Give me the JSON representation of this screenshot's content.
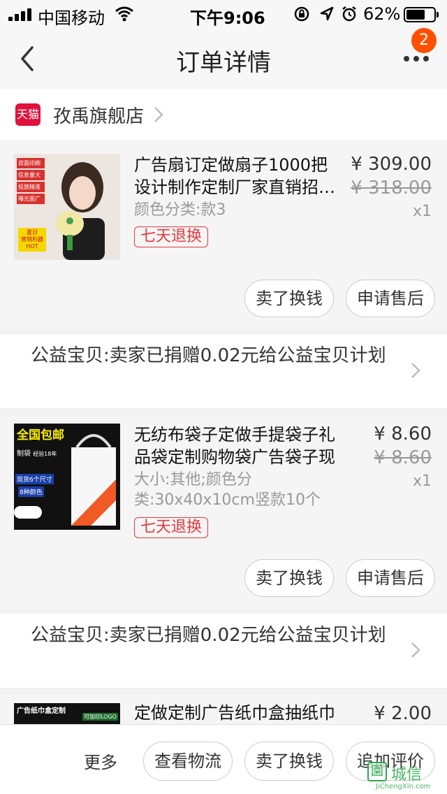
{
  "status_bar": {
    "carrier": "中国移动",
    "time": "下午9:06",
    "battery_percent": "62%",
    "icons": [
      "signal-icon",
      "wifi-icon",
      "lock-rotation-icon",
      "location-arrow-icon",
      "alarm-icon",
      "battery-icon"
    ]
  },
  "nav": {
    "title": "订单详情",
    "badge_count": "2",
    "icons": [
      "back-chevron-icon",
      "more-dots-icon"
    ]
  },
  "shop": {
    "logo_text": "天猫",
    "name": "孜禹旗舰店"
  },
  "items": [
    {
      "title": "广告扇订定做扇子1000把设计制作定制厂家直销招…",
      "sku": "颜色分类:款3",
      "tag": "七天退换",
      "price": "¥ 309.00",
      "original_price": "¥ 318.00",
      "quantity": "x1",
      "buttons": [
        "卖了换钱",
        "申请售后"
      ],
      "thumb_labels": [
        "双面印刷",
        "信息量大",
        "投放精准",
        "曝光面广",
        "夏日",
        "营销利器",
        "HOT"
      ]
    },
    {
      "title": "无纺布袋子定做手提袋子礼品袋定制购物袋广告袋子现货…",
      "sku": "大小:其他;颜色分类:30x40x10cm竖款10个",
      "tag": "七天退换",
      "price": "¥ 8.60",
      "original_price": "¥ 8.60",
      "quantity": "x1",
      "buttons": [
        "卖了换钱",
        "申请售后"
      ],
      "thumb_labels": [
        "全国包邮",
        "制袋",
        "经验18年",
        "现货6个尺寸",
        "8种颜色"
      ]
    },
    {
      "title": "定做定制广告纸巾盒抽纸巾广",
      "price": "¥ 2.00",
      "thumb_labels": [
        "广告纸巾盒定制",
        "可加印LOGO"
      ]
    }
  ],
  "charity": [
    "公益宝贝:卖家已捐赠0.02元给公益宝贝计划",
    "公益宝贝:卖家已捐赠0.02元给公益宝贝计划"
  ],
  "bottom_bar": {
    "more_label": "更多",
    "buttons": [
      "查看物流",
      "卖了换钱",
      "追加评价"
    ]
  },
  "watermark": {
    "cn": "城信",
    "en": "JiChengXin.com"
  },
  "colors": {
    "accent": "#ff5000",
    "tag_red": "#e4393c",
    "tmall_red": "#e0113a"
  }
}
